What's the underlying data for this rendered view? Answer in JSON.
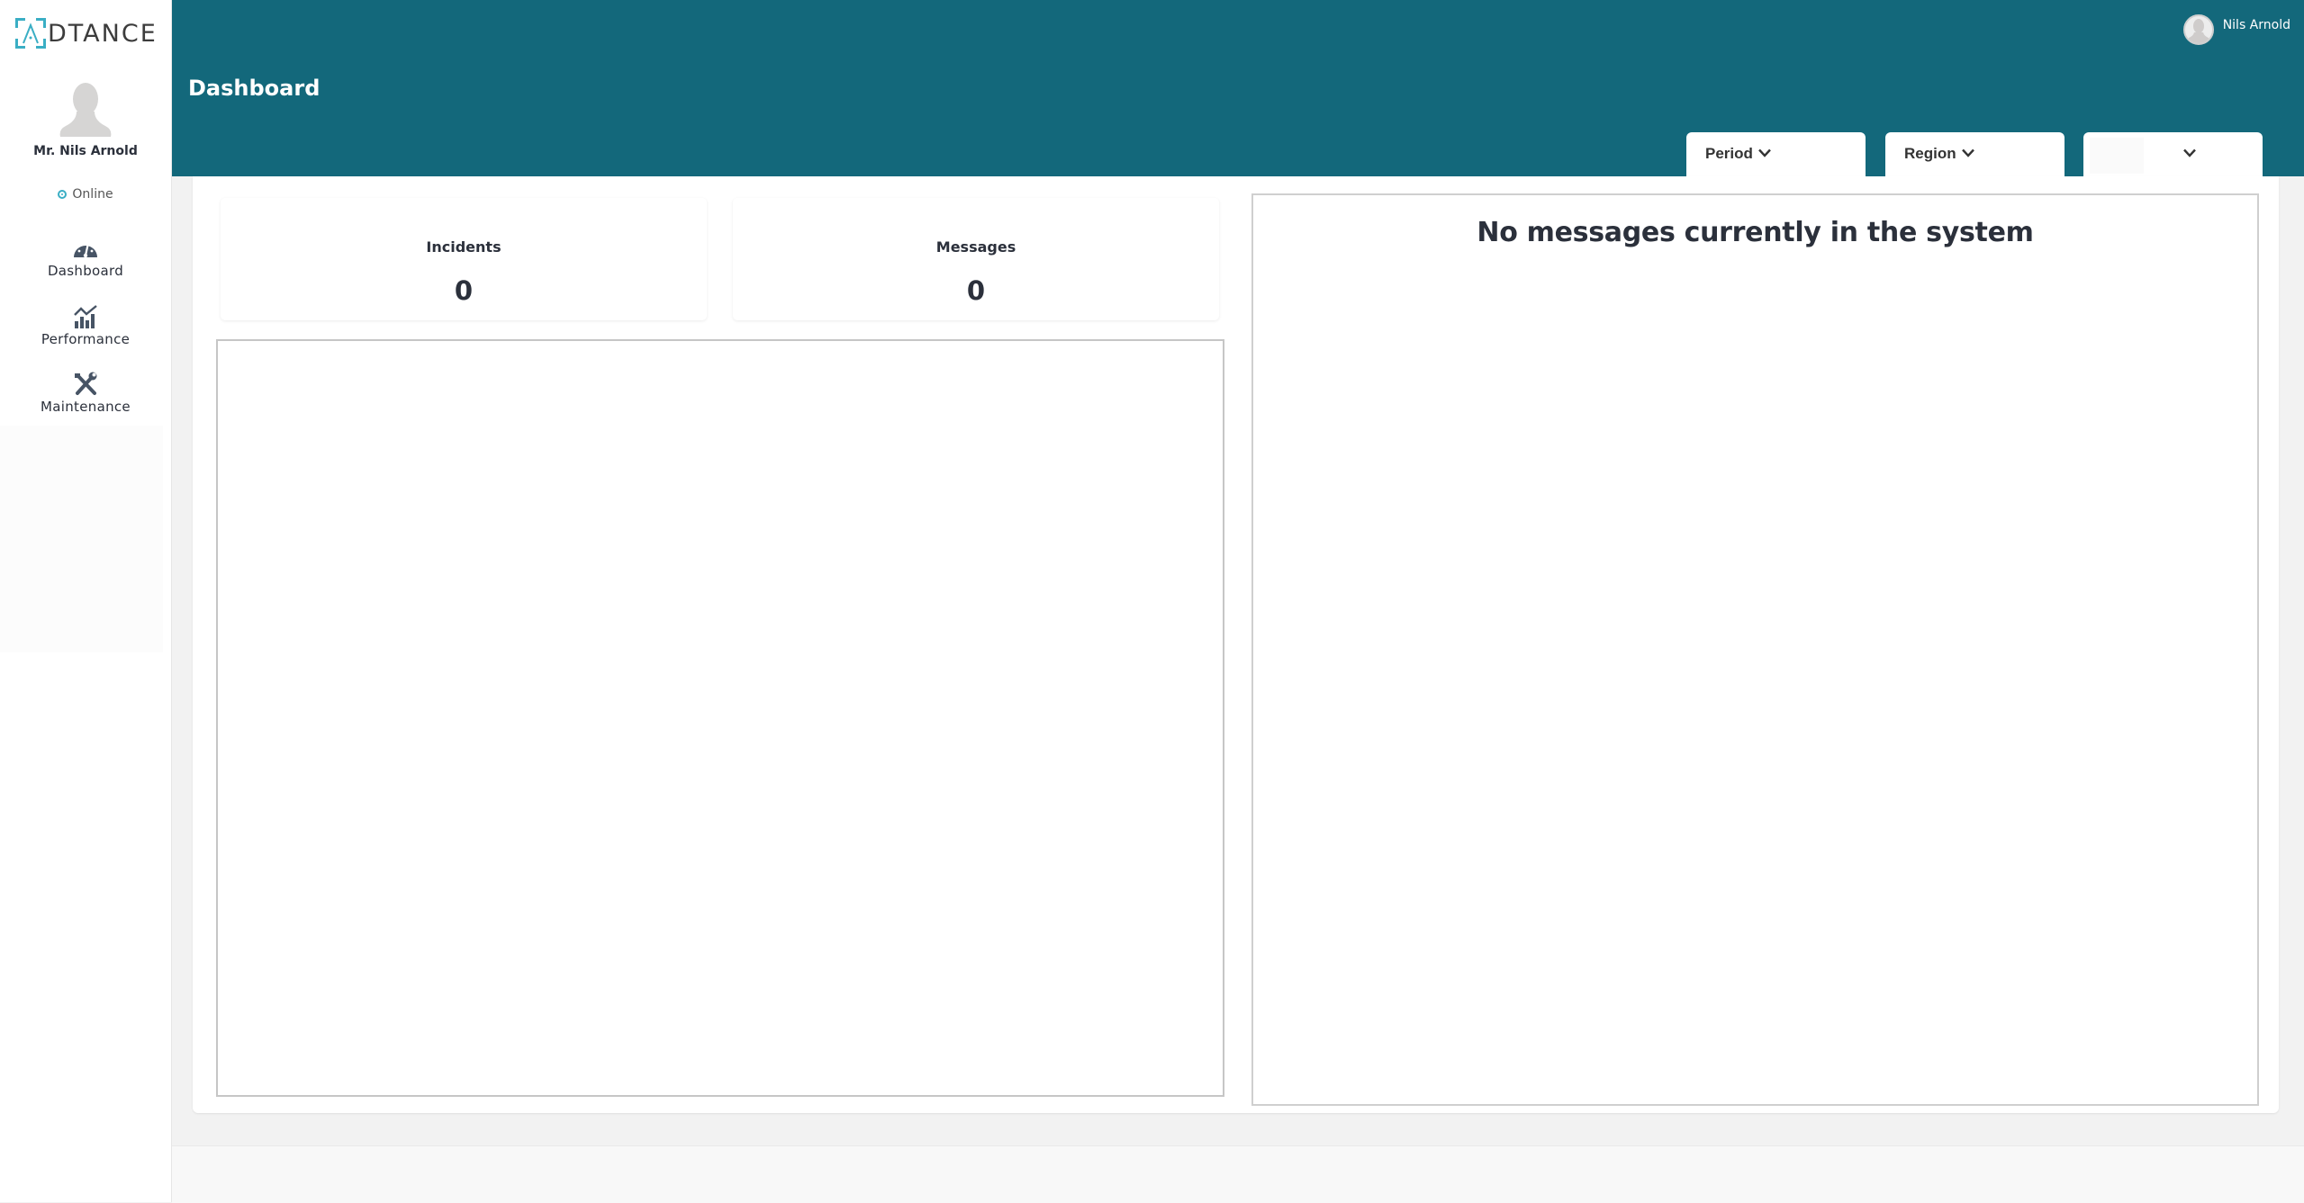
{
  "brand": {
    "logo_text": "DTANCE",
    "accent_color": "#3aaec4",
    "header_color": "#13687b"
  },
  "sidebar": {
    "profile_name": "Mr. Nils Arnold",
    "status": "Online",
    "items": [
      {
        "label": "Dashboard",
        "icon": "dashboard-gauge-icon"
      },
      {
        "label": "Performance",
        "icon": "performance-chart-icon"
      },
      {
        "label": "Maintenance",
        "icon": "maintenance-tools-icon"
      }
    ]
  },
  "header": {
    "title": "Dashboard",
    "user_name": "Nils Arnold",
    "filters": [
      {
        "label": "Period"
      },
      {
        "label": "Region"
      },
      {
        "label": ""
      }
    ]
  },
  "stats": [
    {
      "label": "Incidents",
      "value": "0"
    },
    {
      "label": "Messages",
      "value": "0"
    }
  ],
  "messages_panel": {
    "empty_text": "No messages currently in the system"
  }
}
